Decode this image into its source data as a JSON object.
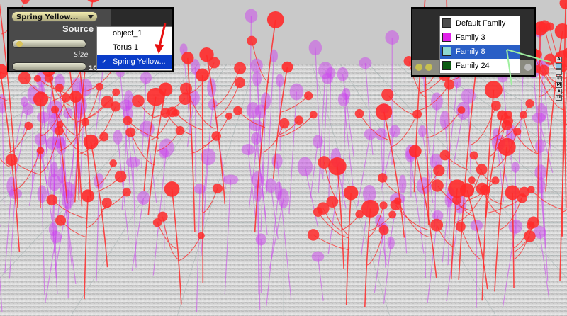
{
  "source_panel": {
    "dropdown_label": "Spring Yellow...",
    "title": "Source",
    "size_label": "Size",
    "value": "10",
    "menu_items": [
      {
        "label": "object_1",
        "checked": false
      },
      {
        "label": "Torus 1",
        "checked": false
      },
      {
        "label": "Spring Yellow...",
        "checked": true
      }
    ],
    "check_glyph": "✓"
  },
  "family_panel": {
    "menu_items": [
      {
        "label": "Default Family",
        "swatch": "#4c4c4c"
      },
      {
        "label": "Family 3",
        "swatch": "#e020e8"
      },
      {
        "label": "Family 8",
        "swatch": "#8ed8d0",
        "selected": true
      },
      {
        "label": "Family 24",
        "swatch": "#0c5c12"
      }
    ]
  },
  "tool_column": [
    "A",
    "",
    "",
    "⊙",
    "M",
    "E",
    "U"
  ],
  "colors": {
    "selection": "#0a3cc8",
    "plants_red": "#ff2a2a",
    "plants_magenta": "#cc44ee",
    "annotation_red": "#e81010",
    "annotation_green": "#9ff0a0"
  },
  "icons": {
    "red_arrow": "arrow-icon",
    "green_arrow": "arrow-icon"
  }
}
